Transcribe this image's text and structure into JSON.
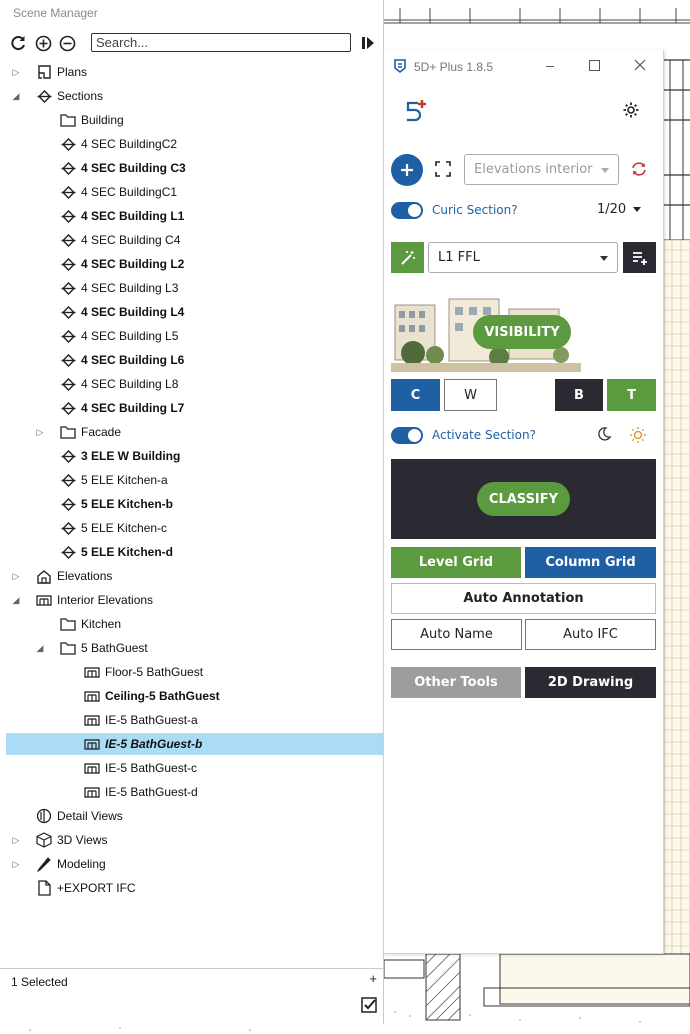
{
  "scene_manager": {
    "title": "Scene Manager",
    "search_placeholder": "Search...",
    "status": "1 Selected",
    "tree": [
      {
        "label": "Plans",
        "icon": "plan-icon",
        "level": 0,
        "expander": "collapsed",
        "bold": false
      },
      {
        "label": "Sections",
        "icon": "section-icon",
        "level": 0,
        "expander": "expanded",
        "bold": false
      },
      {
        "label": "Building",
        "icon": "folder-icon",
        "level": 1,
        "expander": "none",
        "bold": false
      },
      {
        "label": "4 SEC BuildingC2",
        "icon": "section-icon",
        "level": 1,
        "expander": "none",
        "bold": false
      },
      {
        "label": "4 SEC Building C3",
        "icon": "section-icon",
        "level": 1,
        "expander": "none",
        "bold": true
      },
      {
        "label": "4 SEC BuildingC1",
        "icon": "section-icon",
        "level": 1,
        "expander": "none",
        "bold": false
      },
      {
        "label": "4 SEC Building L1",
        "icon": "section-icon",
        "level": 1,
        "expander": "none",
        "bold": true
      },
      {
        "label": "4 SEC Building C4",
        "icon": "section-icon",
        "level": 1,
        "expander": "none",
        "bold": false
      },
      {
        "label": "4 SEC Building L2",
        "icon": "section-icon",
        "level": 1,
        "expander": "none",
        "bold": true
      },
      {
        "label": "4 SEC Building L3",
        "icon": "section-icon",
        "level": 1,
        "expander": "none",
        "bold": false
      },
      {
        "label": "4 SEC Building L4",
        "icon": "section-icon",
        "level": 1,
        "expander": "none",
        "bold": true
      },
      {
        "label": "4 SEC Building L5",
        "icon": "section-icon",
        "level": 1,
        "expander": "none",
        "bold": false
      },
      {
        "label": "4 SEC Building L6",
        "icon": "section-icon",
        "level": 1,
        "expander": "none",
        "bold": true
      },
      {
        "label": "4 SEC Building L8",
        "icon": "section-icon",
        "level": 1,
        "expander": "none",
        "bold": false
      },
      {
        "label": "4 SEC Building L7",
        "icon": "section-icon",
        "level": 1,
        "expander": "none",
        "bold": true
      },
      {
        "label": "Facade",
        "icon": "folder-icon",
        "level": 1,
        "expander": "collapsed",
        "bold": false
      },
      {
        "label": "3 ELE W Building",
        "icon": "section-icon",
        "level": 1,
        "expander": "none",
        "bold": true
      },
      {
        "label": "5 ELE Kitchen-a",
        "icon": "section-icon",
        "level": 1,
        "expander": "none",
        "bold": false
      },
      {
        "label": "5 ELE Kitchen-b",
        "icon": "section-icon",
        "level": 1,
        "expander": "none",
        "bold": true
      },
      {
        "label": "5 ELE Kitchen-c",
        "icon": "section-icon",
        "level": 1,
        "expander": "none",
        "bold": false
      },
      {
        "label": "5 ELE Kitchen-d",
        "icon": "section-icon",
        "level": 1,
        "expander": "none",
        "bold": true
      },
      {
        "label": "Elevations",
        "icon": "elevation-icon",
        "level": 0,
        "expander": "collapsed",
        "bold": false
      },
      {
        "label": "Interior Elevations",
        "icon": "interior-elevation-icon",
        "level": 0,
        "expander": "expanded",
        "bold": false
      },
      {
        "label": "Kitchen",
        "icon": "folder-icon",
        "level": 1,
        "expander": "none",
        "bold": false
      },
      {
        "label": "5 BathGuest",
        "icon": "folder-icon",
        "level": 1,
        "expander": "expanded",
        "bold": false
      },
      {
        "label": "Floor-5 BathGuest",
        "icon": "interior-elevation-icon",
        "level": 2,
        "expander": "none",
        "bold": false
      },
      {
        "label": "Ceiling-5 BathGuest",
        "icon": "interior-elevation-icon",
        "level": 2,
        "expander": "none",
        "bold": true
      },
      {
        "label": "IE-5 BathGuest-a",
        "icon": "interior-elevation-icon",
        "level": 2,
        "expander": "none",
        "bold": false
      },
      {
        "label": "IE-5 BathGuest-b",
        "icon": "interior-elevation-icon",
        "level": 2,
        "expander": "none",
        "bold": true,
        "selected": true
      },
      {
        "label": "IE-5 BathGuest-c",
        "icon": "interior-elevation-icon",
        "level": 2,
        "expander": "none",
        "bold": false
      },
      {
        "label": "IE-5 BathGuest-d",
        "icon": "interior-elevation-icon",
        "level": 2,
        "expander": "none",
        "bold": false
      },
      {
        "label": "Detail Views",
        "icon": "detail-view-icon",
        "level": 0,
        "expander": "none",
        "bold": false
      },
      {
        "label": "3D Views",
        "icon": "cube-icon",
        "level": 0,
        "expander": "collapsed",
        "bold": false
      },
      {
        "label": "Modeling",
        "icon": "pencil-icon",
        "level": 0,
        "expander": "collapsed",
        "bold": false
      },
      {
        "label": "+EXPORT IFC",
        "icon": "document-icon",
        "level": 0,
        "expander": "none",
        "bold": false
      }
    ]
  },
  "plugin": {
    "title": "5D+ Plus 1.8.5",
    "view_dropdown": "Elevations interior",
    "curic_label": "Curic Section?",
    "scale": "1/20",
    "level_dropdown": "L1 FFL",
    "visibility_label": "VISIBILITY",
    "buttons_cwbt": [
      "C",
      "W",
      "B",
      "T"
    ],
    "activate_label": "Activate Section?",
    "classify_label": "CLASSIFY",
    "level_grid": "Level Grid",
    "column_grid": "Column Grid",
    "auto_annotation": "Auto Annotation",
    "auto_name": "Auto Name",
    "auto_ifc": "Auto IFC",
    "other_tools": "Other Tools",
    "drawing_2d": "2D Drawing"
  },
  "colors": {
    "green": "#5b9a3e",
    "blue": "#1f5fa3",
    "dark": "#2b2a33",
    "selection": "#aadcf5",
    "refresh_red": "#c0392b"
  }
}
